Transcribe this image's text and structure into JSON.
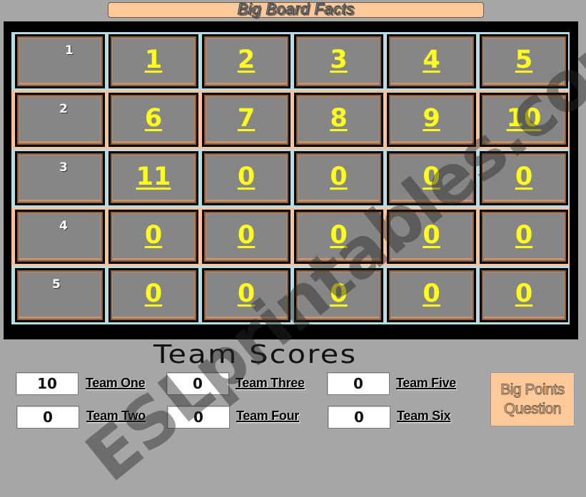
{
  "title": "Big Board Facts",
  "board": {
    "rows": [
      {
        "label": "1",
        "cells": [
          "1",
          "2",
          "3",
          "4",
          "5"
        ]
      },
      {
        "label": "2",
        "cells": [
          "6",
          "7",
          "8",
          "9",
          "10"
        ]
      },
      {
        "label": "3",
        "cells": [
          "11",
          "0",
          "0",
          "0",
          "0"
        ]
      },
      {
        "label": "4",
        "cells": [
          "0",
          "0",
          "0",
          "0",
          "0"
        ]
      },
      {
        "label": "5",
        "cells": [
          "0",
          "0",
          "0",
          "0",
          "0"
        ]
      }
    ]
  },
  "scores": {
    "title": "Team Scores",
    "teams": [
      {
        "name": "Team One",
        "score": "10"
      },
      {
        "name": "Team Two",
        "score": "0"
      },
      {
        "name": "Team Three",
        "score": "0"
      },
      {
        "name": "Team Four",
        "score": "0"
      },
      {
        "name": "Team Five",
        "score": "0"
      },
      {
        "name": "Team Six",
        "score": "0"
      }
    ]
  },
  "big_points_button": {
    "line1": "Big Points",
    "line2": "Question"
  },
  "watermark": "ESLprintables.com",
  "colors": {
    "background": "#a6a6a6",
    "title_bar": "#ffc99a",
    "row_blue": "#b6dde2",
    "row_peach": "#ffc29a",
    "cell_fill": "#868686",
    "points_text": "#ffff1a"
  }
}
